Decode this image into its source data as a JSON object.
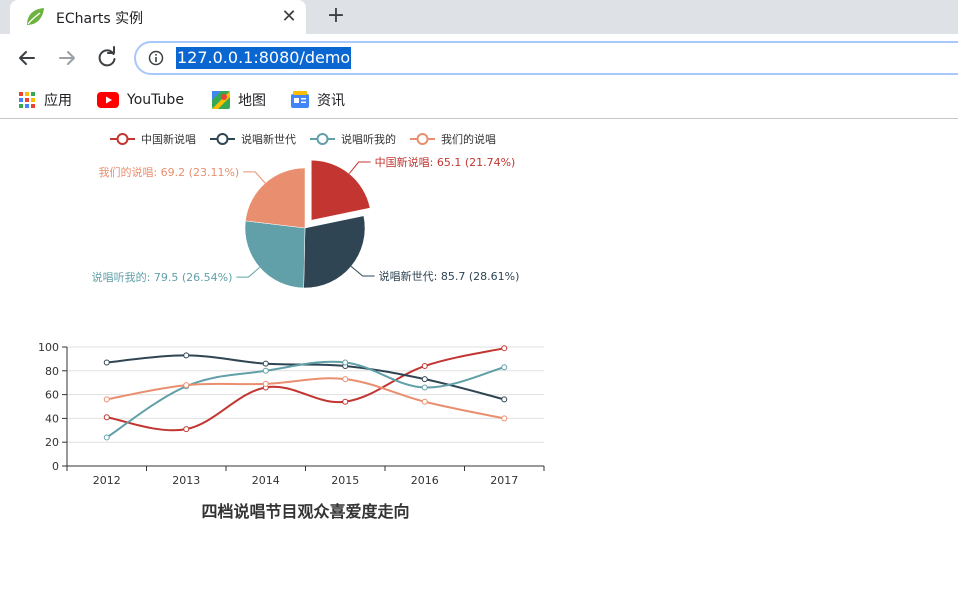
{
  "browser": {
    "tab_title": "ECharts 实例",
    "close_glyph": "✕",
    "newtab_glyph": "+",
    "url": "127.0.0.1:8080/demo",
    "icons": {
      "back": "arrow-left-icon",
      "forward": "arrow-right-icon",
      "reload": "reload-icon",
      "info": "info-icon",
      "favicon": "spring-leaf-icon"
    },
    "bookmarks": [
      {
        "label": "应用",
        "icon": "apps-grid-icon"
      },
      {
        "label": "YouTube",
        "icon": "youtube-icon"
      },
      {
        "label": "地图",
        "icon": "maps-icon"
      },
      {
        "label": "资讯",
        "icon": "news-icon"
      }
    ]
  },
  "chart_data": [
    {
      "type": "pie",
      "legend": [
        "中国新说唱",
        "说唱新世代",
        "说唱听我的",
        "我们的说唱"
      ],
      "legend_placement": "top-center",
      "colors": [
        "#c23531",
        "#2f4554",
        "#61a0a8",
        "#e98f6f"
      ],
      "slices": [
        {
          "name": "中国新说唱",
          "value": 65.1,
          "percent": 21.74,
          "label": "中国新说唱: 65.1 (21.74%)"
        },
        {
          "name": "说唱新世代",
          "value": 85.7,
          "percent": 28.61,
          "label": "说唱新世代: 85.7 (28.61%)"
        },
        {
          "name": "说唱听我的",
          "value": 79.5,
          "percent": 26.54,
          "label": "说唱听我的: 79.5 (26.54%)"
        },
        {
          "name": "我们的说唱",
          "value": 69.2,
          "percent": 23.11,
          "label": "我们的说唱: 69.2 (23.11%)"
        }
      ],
      "selected": "中国新说唱"
    },
    {
      "type": "line",
      "smooth": true,
      "title": "四档说唱节目观众喜爱度走向",
      "categories": [
        "2012",
        "2013",
        "2014",
        "2015",
        "2016",
        "2017"
      ],
      "ylim": [
        0,
        100
      ],
      "yticks": [
        "0",
        "20",
        "40",
        "60",
        "80",
        "100"
      ],
      "grid": true,
      "series": [
        {
          "name": "中国新说唱",
          "color": "#c23531",
          "values": [
            41,
            31,
            66,
            54,
            84,
            99
          ]
        },
        {
          "name": "说唱新世代",
          "color": "#2f4554",
          "values": [
            87,
            93,
            86,
            84,
            73,
            56
          ]
        },
        {
          "name": "说唱听我的",
          "color": "#61a0a8",
          "values": [
            24,
            67,
            80,
            87,
            66,
            83
          ]
        },
        {
          "name": "我们的说唱",
          "color": "#e98f6f",
          "values": [
            56,
            68,
            69,
            73,
            54,
            40
          ]
        }
      ]
    }
  ]
}
